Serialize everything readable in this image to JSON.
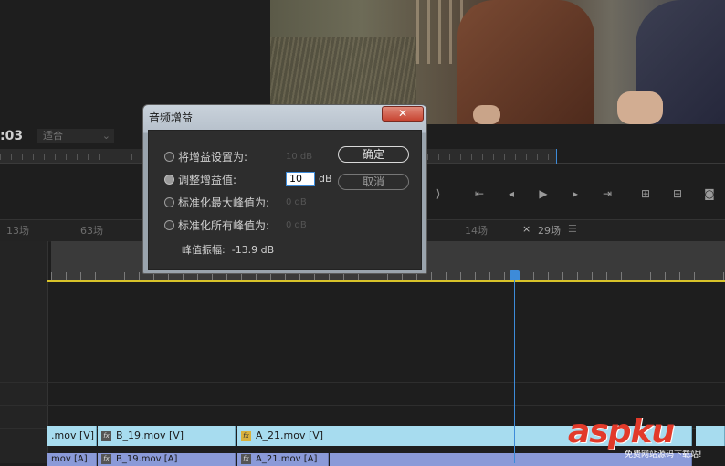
{
  "monitor": {
    "timecode": ":03",
    "fit_select": "适合",
    "transport_icons": [
      "mark-in-icon",
      "step-back-icon",
      "play-icon",
      "step-forward-icon",
      "go-to-out-icon",
      "insert-icon",
      "overwrite-icon",
      "export-frame-icon"
    ]
  },
  "timeline": {
    "tabs": [
      {
        "label": "13场"
      },
      {
        "label": "63场"
      },
      {
        "label": "14场"
      },
      {
        "label": "29场"
      }
    ],
    "close_glyph": "×",
    "menu_glyph": "☰",
    "video_clips": [
      {
        "label": ".mov [V]"
      },
      {
        "label": "B_19.mov [V]"
      },
      {
        "label": "A_21.mov [V]"
      }
    ],
    "audio_clips": [
      {
        "label": "mov [A]"
      },
      {
        "label": "B_19.mov [A]"
      },
      {
        "label": "A_21.mov [A]"
      }
    ],
    "fx_badge": "fx"
  },
  "dialog": {
    "title": "音频增益",
    "close_glyph": "✕",
    "options": [
      {
        "label": "将增益设置为:",
        "value": "10 dB",
        "selected": false
      },
      {
        "label": "调整增益值:",
        "value": "",
        "selected": true
      },
      {
        "label": "标准化最大峰值为:",
        "value": "0 dB",
        "selected": false
      },
      {
        "label": "标准化所有峰值为:",
        "value": "0 dB",
        "selected": false
      }
    ],
    "gain_input_value": "10",
    "gain_unit": "dB",
    "ok_label": "确定",
    "cancel_label": "取消",
    "peak_label": "峰值振幅:",
    "peak_value": "-13.9 dB"
  },
  "watermark": {
    "text": "aspku",
    "sub": "免费网站源码下载站!"
  }
}
